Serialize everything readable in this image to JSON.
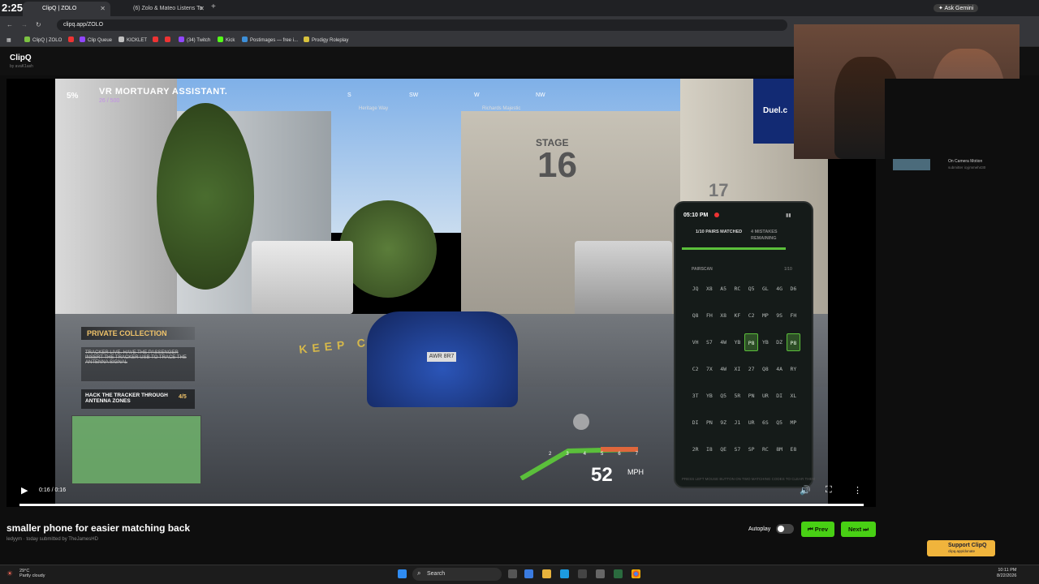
{
  "browser": {
    "clock": "2:25",
    "tabs": [
      {
        "title": "ClipQ | ZOLO",
        "active": true
      },
      {
        "title": "(6) Zolo & Mateo Listens To Pe"
      }
    ],
    "new_tab": "+",
    "url": "clipq.app/ZOLO",
    "ask_gemini": "Ask Gemini",
    "bookmarks": [
      {
        "label": "ClipQ | ZOLO",
        "color": "#7cc242"
      },
      {
        "label": "Clip Queue",
        "color": "#9146ff"
      },
      {
        "label": "KICKLET",
        "color": "#c0c0c0"
      },
      {
        "label": "(34) Twitch",
        "color": "#9146ff"
      },
      {
        "label": "Kick",
        "color": "#53fc18"
      },
      {
        "label": "Postimages — free i...",
        "color": "#3d8fd8"
      },
      {
        "label": "Prodigy Roleplay",
        "color": "#d8c23d"
      }
    ]
  },
  "app": {
    "brand": "ClipQ",
    "brand_sub": "by avaK1ash"
  },
  "game_hud": {
    "percent": "5%",
    "mission": "VR MORTUARY ASSISTANT.",
    "progress": "26 / 500",
    "compass": [
      "S",
      "SW",
      "W",
      "NW"
    ],
    "streets": [
      "Heritage Way",
      "Richards Majestic"
    ],
    "stage_sign": "STAGE",
    "stage_number": "16",
    "building_number": "17",
    "road_text": "KEEP CLEAR",
    "plate": "AWR 8R7",
    "private_collection": "PRIVATE COLLECTION",
    "task_done": "Tracker live. Have the passenger insert the tracker USB to trace the antenna signal",
    "task_active": "HACK THE TRACKER THROUGH ANTENNA ZONES",
    "task_count": "4/5",
    "speed": "52",
    "speed_unit": "MPH",
    "tach_numbers": [
      "2",
      "3",
      "4",
      "5",
      "6",
      "7"
    ]
  },
  "phone": {
    "time": "05:10 PM",
    "pairs": "1/10 PAIRS MATCHED",
    "mistakes": "4 MISTAKES REMAINING",
    "label": "PAIRSCAN",
    "count": "1/10",
    "grid": [
      [
        "JQ",
        "X8",
        "A5",
        "RC",
        "Q5",
        "GL",
        "4G",
        "D6"
      ],
      [
        "Q8",
        "FH",
        "X8",
        "KF",
        "C2",
        "MP",
        "9S",
        "FH"
      ],
      [
        "VH",
        "S7",
        "4W",
        "YB",
        "P8",
        "YB",
        "DZ",
        "P8"
      ],
      [
        "C2",
        "7X",
        "4W",
        "XI",
        "27",
        "Q8",
        "4A",
        "RY"
      ],
      [
        "3T",
        "YB",
        "Q5",
        "5R",
        "PN",
        "UR",
        "DI",
        "XL"
      ],
      [
        "DI",
        "PN",
        "9Z",
        "J1",
        "UR",
        "6S",
        "Q5",
        "MP"
      ],
      [
        "2R",
        "I8",
        "QE",
        "S7",
        "SP",
        "RC",
        "8M",
        "E8"
      ]
    ],
    "highlighted": [
      "2-4",
      "2-7"
    ],
    "hint": "PRESS LEFT MOUSE BUTTON ON TWO MATCHING CODES TO CLEAR THEM"
  },
  "player": {
    "time": "0:16 / 0:16",
    "progress": 1.0
  },
  "overlay": {
    "duel": "Duel.c"
  },
  "sidebar": {
    "clip_title": "On Camera Motion",
    "clip_sub": "submitter icyjmmeh430",
    "support_title": "Support ClipQ",
    "support_sub": "clipq.app/donate"
  },
  "clip": {
    "title": "smaller phone for easier matching back",
    "meta": "ledyym · today submitted by TheJamesHD"
  },
  "controls": {
    "autoplay": "Autoplay",
    "prev": "⏮ Prev",
    "next": "Next ⏭"
  },
  "taskbar": {
    "temp": "29°C",
    "condition": "Partly cloudy",
    "search": "Search",
    "time": "10:11 PM",
    "date": "8/22/2026"
  }
}
